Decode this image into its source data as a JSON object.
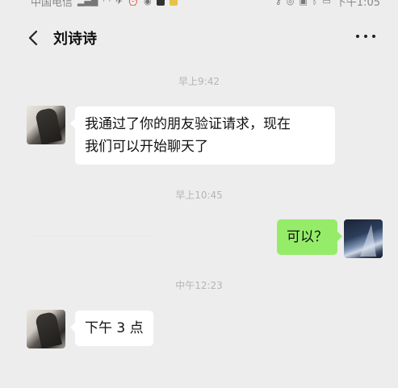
{
  "status_bar": {
    "carrier": "中国电信",
    "time": "下午1:05"
  },
  "header": {
    "back_icon": "chevron-left-icon",
    "title": "刘诗诗",
    "more_icon": "more-horizontal-icon"
  },
  "messages": [
    {
      "type": "timestamp",
      "text": "早上9:42"
    },
    {
      "type": "incoming",
      "lines": [
        "我通过了你的朋友验证请求，现在",
        "我们可以开始聊天了"
      ]
    },
    {
      "type": "timestamp",
      "text": "早上10:45"
    },
    {
      "type": "outgoing",
      "text": "可以？"
    },
    {
      "type": "timestamp",
      "text": "中午12:23"
    },
    {
      "type": "incoming",
      "text": "下午 3 点"
    }
  ],
  "colors": {
    "background": "#ededed",
    "incoming_bubble": "#ffffff",
    "outgoing_bubble": "#95ec69",
    "timestamp_text": "#b5b5b5"
  }
}
